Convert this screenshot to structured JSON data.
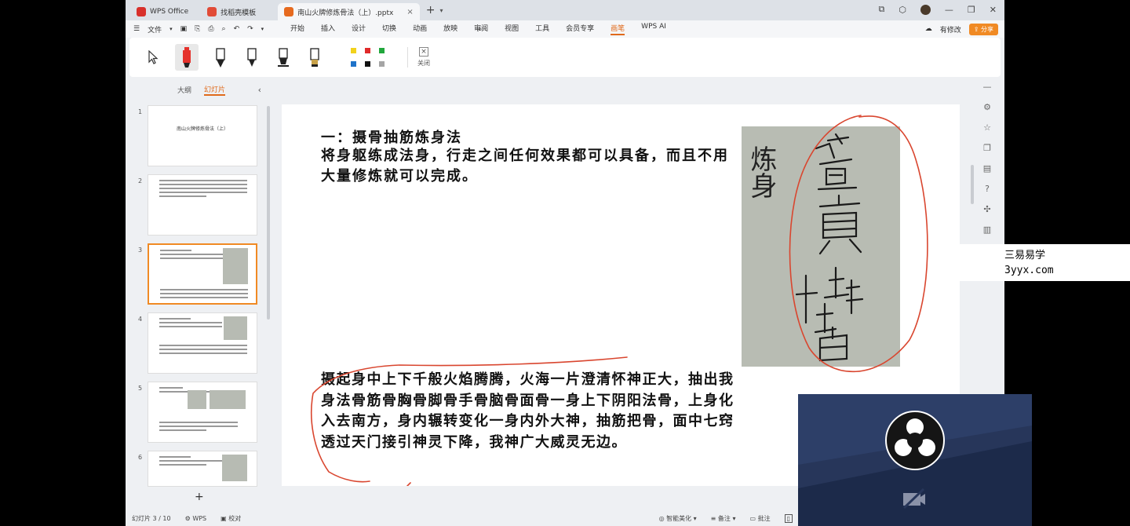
{
  "titlebar": {
    "tabs": [
      {
        "label": "WPS Office",
        "color": "#d8302b"
      },
      {
        "label": "找稻壳模板",
        "color": "#e14b37"
      },
      {
        "label": "南山火牌修炼骨法（上）.pptx",
        "color": "#e66a1f"
      }
    ]
  },
  "menubar": {
    "file_label": "文件",
    "menus": [
      "开始",
      "插入",
      "设计",
      "切换",
      "动画",
      "放映",
      "审阅",
      "视图",
      "工具",
      "会员专享",
      "画笔",
      "WPS AI"
    ],
    "active_menu": "画笔",
    "edit_label": "有修改",
    "share_label": "分享"
  },
  "ribbon": {
    "close_label": "关闭",
    "colors": [
      "#f2d21c",
      "#e02a2a",
      "#21a73c",
      "#1f73c9",
      "#111111",
      "#a5a5a5"
    ]
  },
  "leftpanel": {
    "tabs": [
      "大纲",
      "幻灯片"
    ],
    "active_tab": "幻灯片",
    "thumbs": [
      {
        "num": "1",
        "title": "南山火牌修炼骨法（上）"
      },
      {
        "num": "2"
      },
      {
        "num": "3"
      },
      {
        "num": "4"
      },
      {
        "num": "5"
      },
      {
        "num": "6"
      }
    ]
  },
  "slide": {
    "title": "一：摄骨抽筋炼身法",
    "para1": "将身躯练成法身，行走之间任何效果都可以具备，而且不用大量修炼就可以完成。",
    "para2": "摄起身中上下千般火焰腾腾，火海一片澄清怀神正大，抽出我身法骨筋骨胸骨脚骨手骨脑骨面骨一身上下阴阳法骨，上身化入去南方，身内辗转变化一身内外大神，抽筋把骨，面中七窍透过天门接引神灵下降，我神广大威灵无边。",
    "talisman_side": "炼身"
  },
  "statusbar": {
    "slide_info": "幻灯片 3 / 10",
    "wps_label": "WPS",
    "proof_label": "校对",
    "smart_label": "智能美化",
    "notes_label": "备注",
    "comment_label": "批注"
  },
  "watermark": {
    "line1": "三易易学",
    "line2": "3yyx.com"
  }
}
